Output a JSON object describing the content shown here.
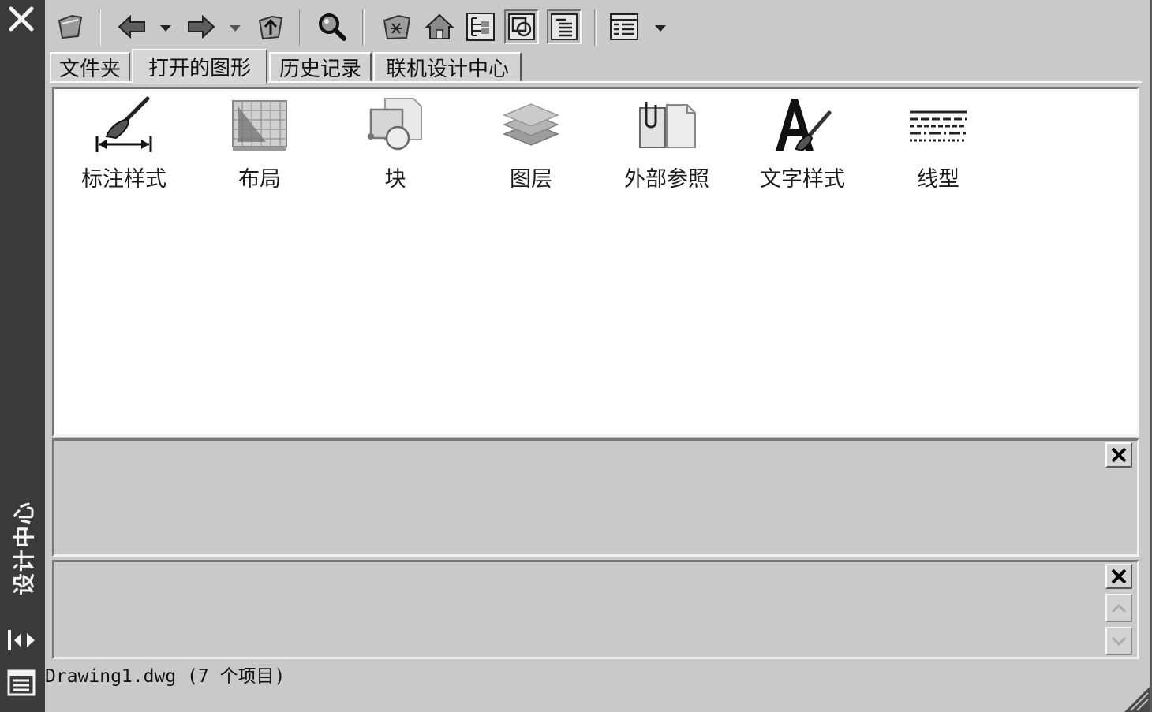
{
  "window": {
    "title": "设计中心",
    "close_icon": "close-icon",
    "autohide_icon": "autohide-icon",
    "properties_icon": "properties-icon"
  },
  "toolbar": {
    "buttons": [
      {
        "id": "load",
        "icon": "load-folder-icon"
      },
      {
        "id": "back",
        "icon": "back-arrow-icon"
      },
      {
        "id": "forward",
        "icon": "forward-arrow-icon"
      },
      {
        "id": "up",
        "icon": "up-folder-icon"
      },
      {
        "id": "search",
        "icon": "search-icon"
      },
      {
        "id": "favorites",
        "icon": "favorites-icon"
      },
      {
        "id": "home",
        "icon": "home-icon"
      },
      {
        "id": "tree",
        "icon": "tree-view-toggle-icon"
      },
      {
        "id": "preview",
        "icon": "preview-toggle-icon",
        "pressed": true
      },
      {
        "id": "description",
        "icon": "description-toggle-icon",
        "pressed": true
      },
      {
        "id": "views",
        "icon": "views-icon"
      }
    ]
  },
  "tabs": [
    {
      "label": "文件夹",
      "active": false
    },
    {
      "label": "打开的图形",
      "active": true
    },
    {
      "label": "历史记录",
      "active": false
    },
    {
      "label": "联机设计中心",
      "active": false
    }
  ],
  "content": {
    "items": [
      {
        "label": "标注样式",
        "icon": "dimension-style-icon"
      },
      {
        "label": "布局",
        "icon": "layout-icon"
      },
      {
        "label": "块",
        "icon": "block-icon"
      },
      {
        "label": "图层",
        "icon": "layers-icon"
      },
      {
        "label": "外部参照",
        "icon": "xref-icon"
      },
      {
        "label": "文字样式",
        "icon": "text-style-icon"
      },
      {
        "label": "线型",
        "icon": "linetype-icon"
      }
    ]
  },
  "status": {
    "text": "Drawing1.dwg (7 个项目)"
  }
}
